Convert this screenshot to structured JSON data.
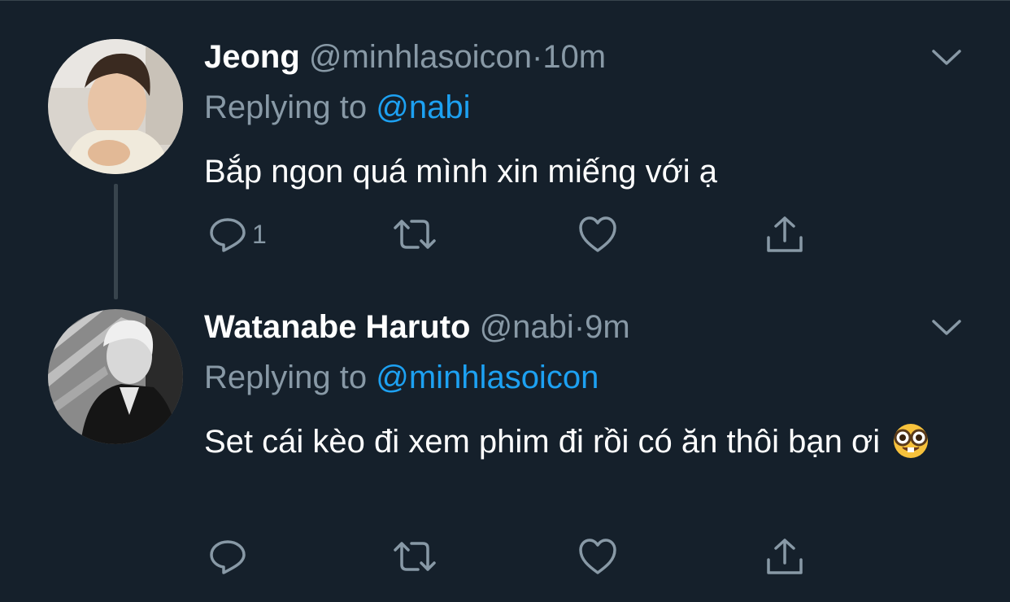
{
  "tweets": [
    {
      "name": "Jeong",
      "handle": "@minhlasoicon",
      "separator": "·",
      "time": "10m",
      "replying_label": "Replying to",
      "replying_to": "@nabi",
      "text": "Bắp ngon quá mình xin miếng với ạ",
      "reply_count": "1",
      "avatar_icon": "avatar-photo-jeong"
    },
    {
      "name": "Watanabe Haruto",
      "handle": "@nabi",
      "separator": "·",
      "time": "9m",
      "replying_label": "Replying to",
      "replying_to": "@minhlasoicon",
      "text": "Set cái kèo đi xem phim đi rồi có ăn thôi bạn ơi",
      "emoji": "nerd-face-emoji",
      "avatar_icon": "avatar-photo-haruto"
    }
  ],
  "colors": {
    "background": "#15202b",
    "primary_text": "#ffffff",
    "secondary_text": "#8899a6",
    "accent": "#1da1f2",
    "divider": "#38444d"
  },
  "icons": [
    "reply-icon",
    "retweet-icon",
    "like-icon",
    "share-icon",
    "chevron-down-icon"
  ]
}
